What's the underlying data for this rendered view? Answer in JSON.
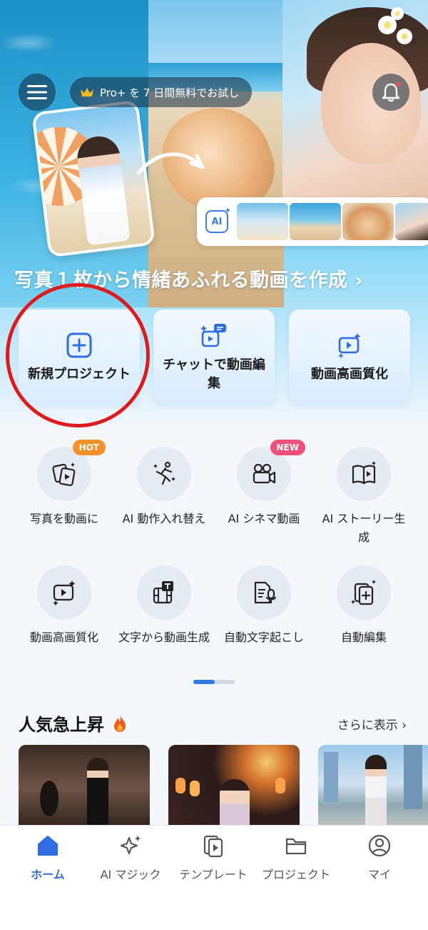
{
  "hero": {
    "promo_label": "Pro+ を 7 日間無料でお試し",
    "headline": "写真１枚から情緒あふれる動画を作成 ›",
    "ai_badge": "AI"
  },
  "actions": [
    {
      "label": "新規プロジェクト",
      "icon": "plus-square-icon"
    },
    {
      "label": "チャットで動画編集",
      "icon": "chat-video-icon"
    },
    {
      "label": "動画高画質化",
      "icon": "video-enhance-icon"
    }
  ],
  "features": [
    {
      "label": "写真を動画に",
      "icon": "photo-to-video-icon",
      "tag": "HOT"
    },
    {
      "label": "AI 動作入れ替え",
      "icon": "motion-swap-icon",
      "tag": ""
    },
    {
      "label": "AI シネマ動画",
      "icon": "cinema-camera-icon",
      "tag": "NEW"
    },
    {
      "label": "AI ストーリー生成",
      "icon": "story-book-icon",
      "tag": ""
    },
    {
      "label": "動画高画質化",
      "icon": "video-enhance-icon",
      "tag": ""
    },
    {
      "label": "文字から動画生成",
      "icon": "text-to-video-icon",
      "tag": ""
    },
    {
      "label": "自動文字起こし",
      "icon": "transcribe-icon",
      "tag": ""
    },
    {
      "label": "自動編集",
      "icon": "auto-edit-icon",
      "tag": ""
    }
  ],
  "trending": {
    "title": "人気急上昇",
    "more_label": "さらに表示 ›"
  },
  "tabs": [
    {
      "label": "ホーム",
      "icon": "home-icon",
      "active": true
    },
    {
      "label": "AI マジック",
      "icon": "sparkle-icon",
      "active": false
    },
    {
      "label": "テンプレート",
      "icon": "template-icon",
      "active": false
    },
    {
      "label": "プロジェクト",
      "icon": "folder-icon",
      "active": false
    },
    {
      "label": "マイ",
      "icon": "user-icon",
      "active": false
    }
  ],
  "colors": {
    "accent": "#2f6ee0",
    "hot_tag": "#f5902b",
    "new_tag": "#f0507a",
    "annotation_circle": "#e0191c"
  }
}
